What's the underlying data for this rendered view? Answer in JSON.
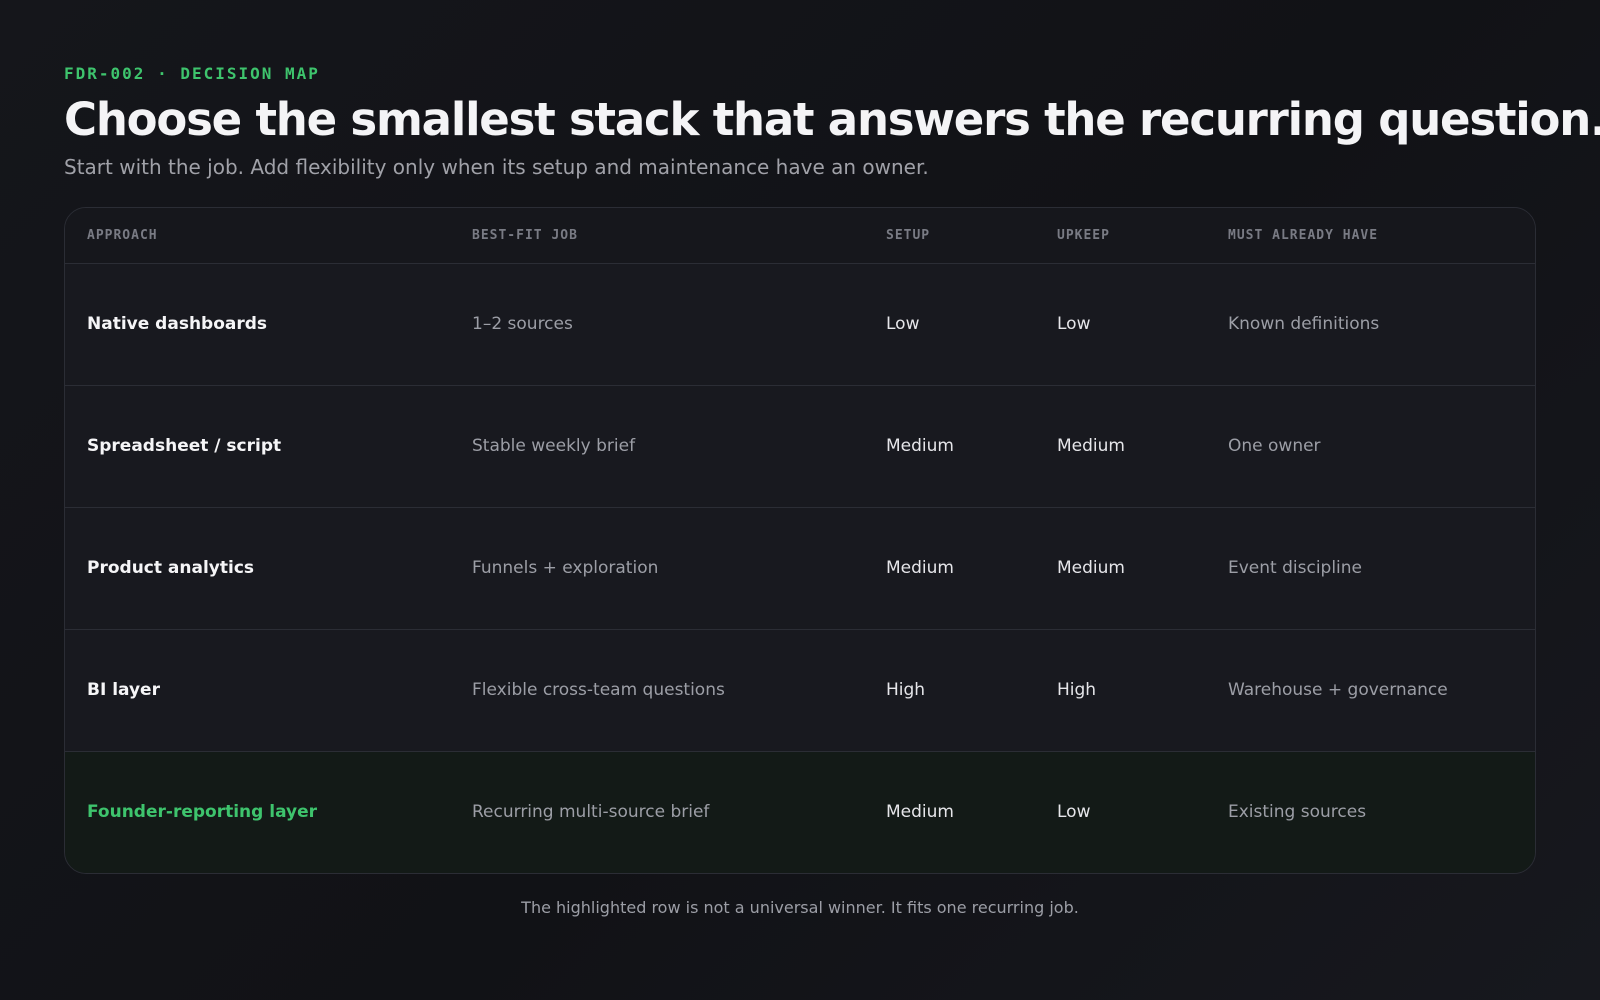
{
  "header": {
    "eyebrow": "FDR-002 · DECISION MAP",
    "title": "Choose the smallest stack that answers the recurring question.",
    "subtitle": "Start with the job. Add flexibility only when its setup and maintenance have an owner."
  },
  "table": {
    "columns": [
      "APPROACH",
      "BEST-FIT JOB",
      "SETUP",
      "UPKEEP",
      "MUST ALREADY HAVE"
    ],
    "rows": [
      {
        "approach": "Native dashboards",
        "job": "1–2 sources",
        "setup": "Low",
        "upkeep": "Low",
        "prereq": "Known definitions",
        "highlighted": false
      },
      {
        "approach": "Spreadsheet / script",
        "job": "Stable weekly brief",
        "setup": "Medium",
        "upkeep": "Medium",
        "prereq": "One owner",
        "highlighted": false
      },
      {
        "approach": "Product analytics",
        "job": "Funnels + exploration",
        "setup": "Medium",
        "upkeep": "Medium",
        "prereq": "Event discipline",
        "highlighted": false
      },
      {
        "approach": "BI layer",
        "job": "Flexible cross-team questions",
        "setup": "High",
        "upkeep": "High",
        "prereq": "Warehouse + governance",
        "highlighted": false
      },
      {
        "approach": "Founder-reporting layer",
        "job": "Recurring multi-source brief",
        "setup": "Medium",
        "upkeep": "Low",
        "prereq": "Existing sources",
        "highlighted": true
      }
    ]
  },
  "footnote": "The highlighted row is not a universal winner. It fits one recurring job.",
  "colors": {
    "accent": "#3ec46d",
    "background": "#121318",
    "highlight_row": "#131a17"
  }
}
